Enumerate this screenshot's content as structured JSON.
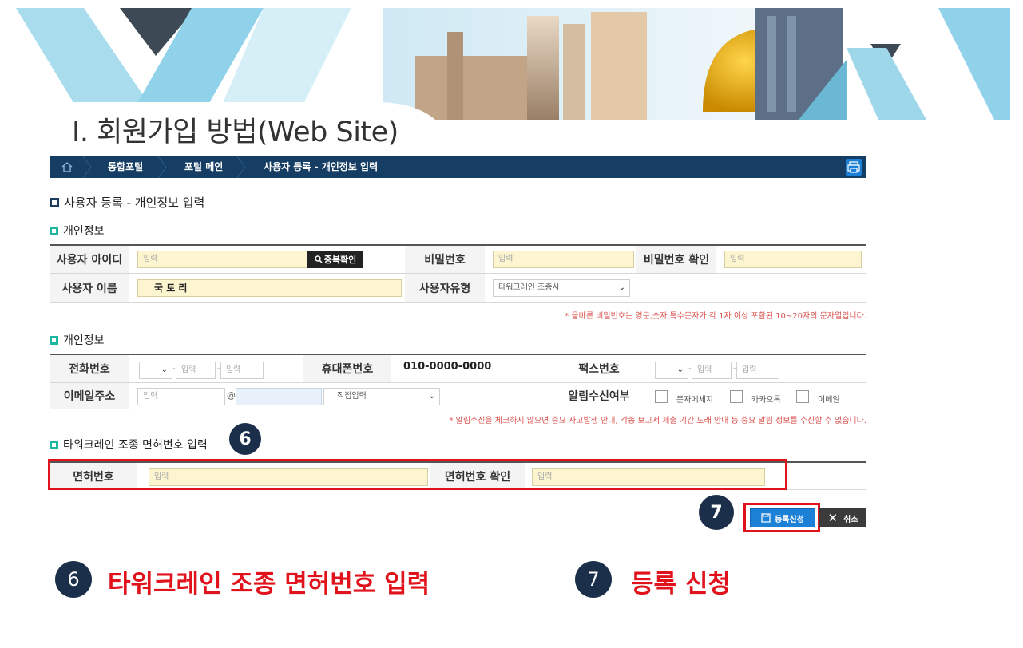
{
  "slide": {
    "title": "Ⅰ. 회원가입 방법(Web Site)"
  },
  "breadcrumb": {
    "items": [
      "통합포털",
      "포털 메인",
      "사용자 등록 - 개인정보 입력"
    ]
  },
  "page": {
    "heading": "사용자 등록 - 개인정보 입력"
  },
  "sections": {
    "personal_info": "개인정보",
    "contact_info": "개인정보",
    "license": "타워크레인 조종 면허번호 입력"
  },
  "fields": {
    "user_id": {
      "label": "사용자 아이디",
      "placeholder": "입력",
      "check_button": "중복확인"
    },
    "password": {
      "label": "비밀번호",
      "placeholder": "입력"
    },
    "password_confirm": {
      "label": "비밀번호 확인",
      "placeholder": "입력"
    },
    "user_name": {
      "label": "사용자 이름",
      "value": "국 토 리"
    },
    "user_type": {
      "label": "사용자유형",
      "value": "타워크레인 조종사"
    },
    "password_note": "* 올바른 비밀번호는 영문,숫자,특수문자가 각 1자 이상 포함된 10~20자의 문자열입니다.",
    "phone": {
      "label": "전화번호",
      "placeholder": "입력",
      "sep": "-"
    },
    "mobile": {
      "label": "휴대폰번호",
      "value": "010-0000-0000"
    },
    "fax": {
      "label": "팩스번호",
      "placeholder": "입력",
      "sep": "-"
    },
    "email": {
      "label": "이메일주소",
      "placeholder": "입력",
      "at": "@",
      "domain_select": "직접입력"
    },
    "notify": {
      "label": "알림수신여부",
      "options": [
        "문자메세지",
        "카카오톡",
        "이메일"
      ]
    },
    "notify_note": "* 알림수신을 체크하지 않으면 중요 사고발생 안내, 각종 보고서 제출 기간 도래 안내 등 중요 알림 정보를 수신할 수 없습니다.",
    "license_no": {
      "label": "면허번호",
      "placeholder": "입력"
    },
    "license_confirm": {
      "label": "면허번호 확인",
      "placeholder": "입력"
    }
  },
  "buttons": {
    "submit": "등록신청",
    "cancel": "취소"
  },
  "steps": {
    "six": "6",
    "seven": "7"
  },
  "captions": {
    "six": "타워크레인 조종 면허번호 입력",
    "seven": "등록 신청"
  },
  "colors": {
    "navbar": "#163e64",
    "accent": "#1c80d6",
    "highlight": "#e0121b",
    "input_bg": "#fdf5cf"
  }
}
